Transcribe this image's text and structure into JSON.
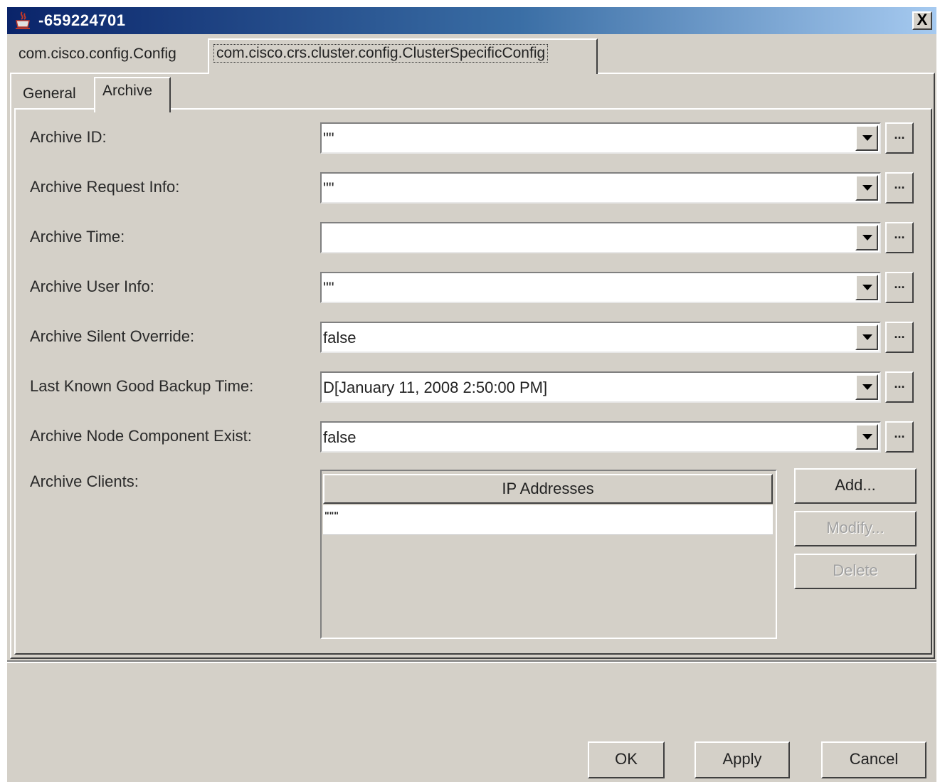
{
  "window": {
    "title": "-659224701",
    "close_label": "X"
  },
  "outer_tabs": [
    {
      "label": "com.cisco.config.Config"
    },
    {
      "label": "com.cisco.crs.cluster.config.ClusterSpecificConfig",
      "selected": true
    }
  ],
  "inner_tabs": [
    {
      "label": "General"
    },
    {
      "label": "Archive",
      "selected": true
    }
  ],
  "fields": [
    {
      "label": "Archive ID:",
      "value": "\"\""
    },
    {
      "label": "Archive Request Info:",
      "value": "\"\""
    },
    {
      "label": "Archive Time:",
      "value": ""
    },
    {
      "label": "Archive User Info:",
      "value": "\"\""
    },
    {
      "label": "Archive Silent Override:",
      "value": "false"
    },
    {
      "label": "Last Known Good Backup Time:",
      "value": "D[January 11, 2008 2:50:00 PM]"
    },
    {
      "label": "Archive Node Component Exist:",
      "value": "false"
    }
  ],
  "ellipsis_label": "...",
  "clients": {
    "label": "Archive Clients:",
    "column_header": "IP Addresses",
    "rows": [
      "\"\"\""
    ],
    "buttons": {
      "add": "Add...",
      "modify": "Modify...",
      "delete": "Delete"
    }
  },
  "footer": {
    "ok": "OK",
    "apply": "Apply",
    "cancel": "Cancel"
  }
}
